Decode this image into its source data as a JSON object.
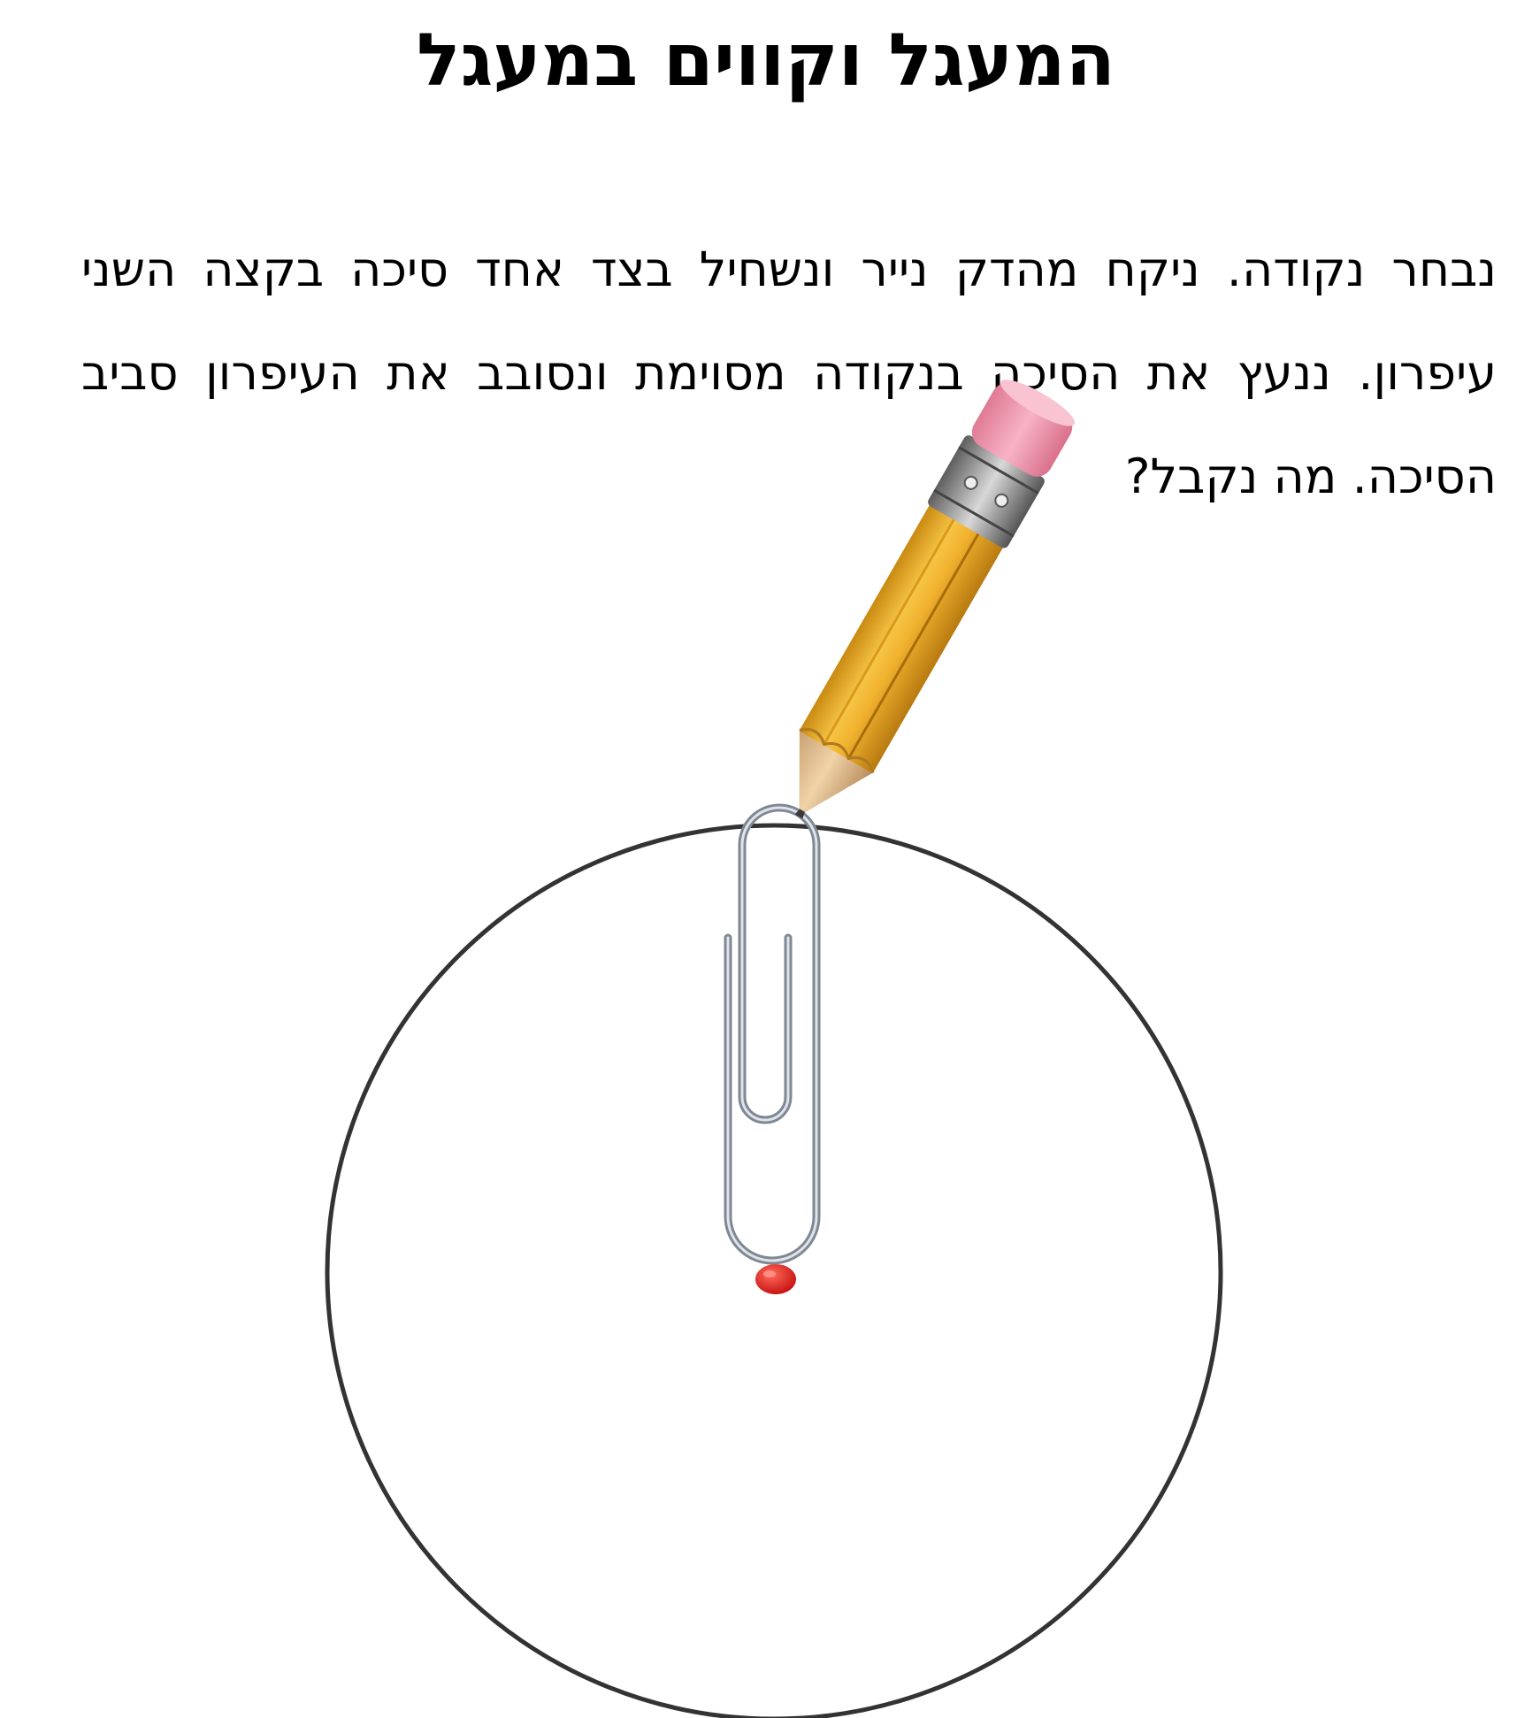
{
  "title": "המעגל וקווים במעגל",
  "instructions": {
    "lines": [
      "נבחר נקודה. ניקח מהדק נייר ונשחיל בצד אחד סיכה בקצה השני",
      "עיפרון. ננעץ את הסיכה בנקודה מסוימת ונסובב את העיפרון סביב",
      "הסיכה. מה נקבל?"
    ]
  },
  "diagram": {
    "circle_color": "#333333",
    "pin_color": "#d11a1a",
    "pencil_body_color": "#f2b330",
    "eraser_color": "#f29ab0",
    "ferrule_color": "#8c8c8c",
    "clip_color": "#9aa3ad"
  }
}
